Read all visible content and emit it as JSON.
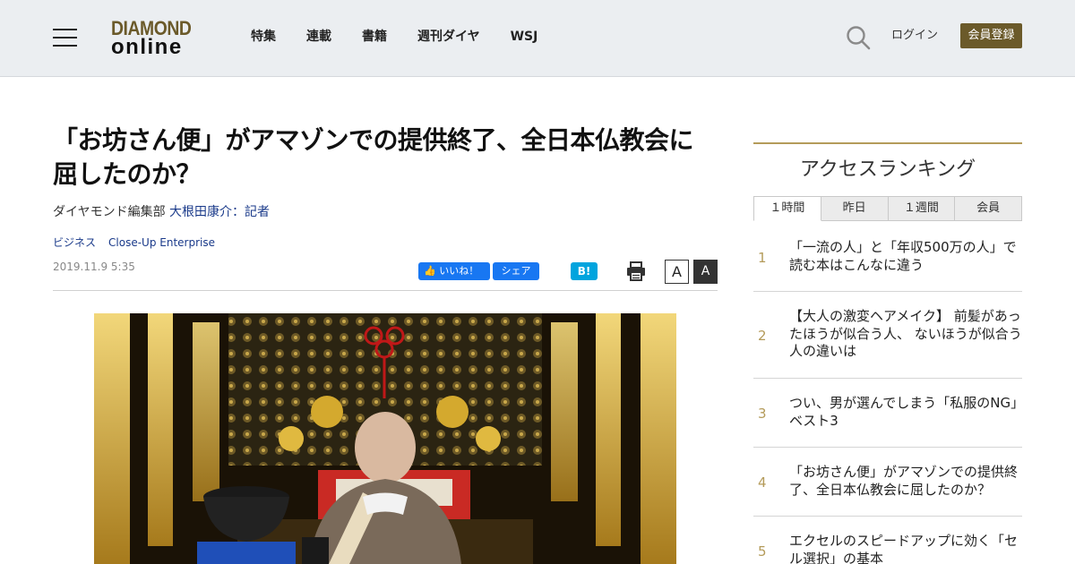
{
  "header": {
    "logo_top": "DIAMOND",
    "logo_bottom": "online",
    "nav": [
      "特集",
      "連載",
      "書籍",
      "週刊ダイヤ",
      "WSJ"
    ],
    "login": "ログイン",
    "register": "会員登録"
  },
  "article": {
    "title": "「お坊さん便」がアマゾンでの提供終了、全日本仏教会に屈したのか？",
    "byline_prefix": "ダイヤモンド編集部",
    "author": "大根田康介：記者",
    "tags": [
      "ビジネス",
      "Close-Up Enterprise"
    ],
    "date": "2019.11.9 5:35",
    "fb_like": "いいね！",
    "fb_share": "シェア",
    "hatena": "B!",
    "font_small": "A",
    "font_large": "A"
  },
  "ranking": {
    "title": "アクセスランキング",
    "tabs": [
      "１時間",
      "昨日",
      "１週間",
      "会員"
    ],
    "active_tab": 0,
    "items": [
      {
        "rank": "1",
        "text": "「一流の人」と「年収500万の人」で読む本はこんなに違う"
      },
      {
        "rank": "2",
        "text": "【大人の激変ヘアメイク】 前髪があったほうが似合う人、 ないほうが似合う人の違いは"
      },
      {
        "rank": "3",
        "text": "つい、男が選んでしまう「私服のNG」ベスト3"
      },
      {
        "rank": "4",
        "text": "「お坊さん便」がアマゾンでの提供終了、全日本仏教会に屈したのか？"
      },
      {
        "rank": "5",
        "text": "エクセルのスピードアップに効く「セル選択」の基本"
      }
    ]
  },
  "colors": {
    "brand_gold": "#6b5a2a",
    "rank_gold": "#b49b5a",
    "link_blue": "#1a3a8a",
    "facebook": "#1877f2",
    "hatena": "#00a4de"
  }
}
